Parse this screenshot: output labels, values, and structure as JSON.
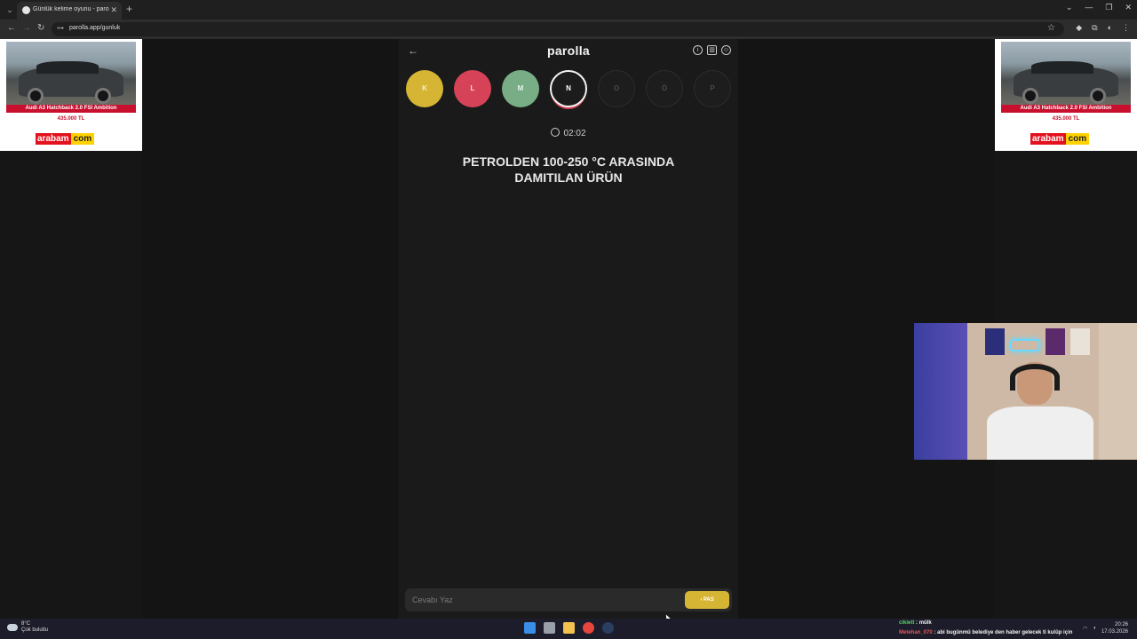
{
  "browser": {
    "tab_title": "Günlük kelime oyunu - parolla",
    "url": "parolla.app/gunluk",
    "new_tab": "+",
    "tab_close": "✕",
    "tab_list": "⌄",
    "win_controls": [
      "⌄",
      "—",
      "❐",
      "✕"
    ]
  },
  "ads": {
    "left": {
      "title": "Audi A3 Hatchback 2.0 FSI Ambition",
      "price": "435.000 TL",
      "logo_a": "arabam",
      "logo_b": "com"
    },
    "right": {
      "title": "Audi A3 Hatchback 2.0 FSI Ambition",
      "price": "435.000 TL",
      "logo_a": "arabam",
      "logo_b": "com"
    }
  },
  "game": {
    "logo": "parolla",
    "back": "←",
    "letters": [
      {
        "char": "K",
        "state": "yellow"
      },
      {
        "char": "L",
        "state": "red"
      },
      {
        "char": "M",
        "state": "green"
      },
      {
        "char": "N",
        "state": "active"
      },
      {
        "char": "O",
        "state": "pending"
      },
      {
        "char": "Ö",
        "state": "pending"
      },
      {
        "char": "P",
        "state": "pending"
      }
    ],
    "timer": "02:02",
    "question_line1": "PETROLDEN 100-250 °C ARASINDA",
    "question_line2": "DAMITILAN ÜRÜN",
    "answer_placeholder": "Cevabı Yaz",
    "pass_label": "PAS",
    "pass_chevron": "›"
  },
  "chat": [
    {
      "user": "cikiett",
      "sep": " : ",
      "msg": "mülk"
    },
    {
      "user": "Metehan_070",
      "sep": " : ",
      "msg": "abi bugünmü belediye den haber gelecek ti kulüp için"
    }
  ],
  "taskbar": {
    "weather_temp": "8°C",
    "weather_desc": "Çok bulutlu",
    "time": "20:26",
    "date": "17.03.2026"
  },
  "colors": {
    "yellow": "#d6b534",
    "red": "#d64358",
    "green": "#78ad85"
  }
}
